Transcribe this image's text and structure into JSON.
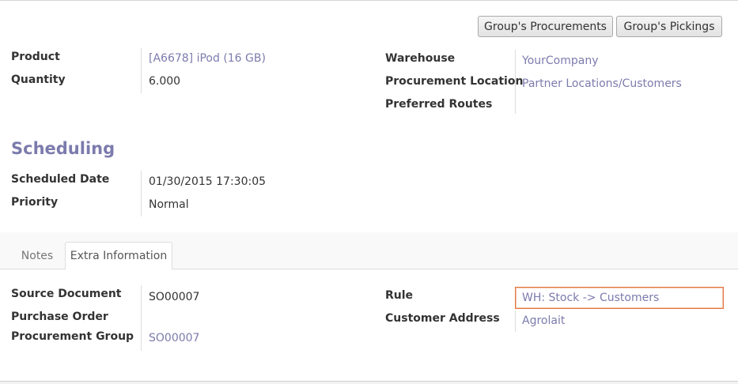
{
  "header": {
    "group_procurements_button": "Group's Procurements",
    "group_pickings_button": "Group's Pickings"
  },
  "main": {
    "product_label": "Product",
    "product_value": "[A6678] iPod (16 GB)",
    "quantity_label": "Quantity",
    "quantity_value": "6.000",
    "warehouse_label": "Warehouse",
    "warehouse_value": "YourCompany",
    "procurement_location_label": "Procurement Location",
    "procurement_location_value": "Partner Locations/Customers",
    "preferred_routes_label": "Preferred Routes"
  },
  "scheduling": {
    "title": "Scheduling",
    "scheduled_date_label": "Scheduled Date",
    "scheduled_date_value": "01/30/2015 17:30:05",
    "priority_label": "Priority",
    "priority_value": "Normal"
  },
  "tabs": [
    {
      "label": "Notes",
      "active": false
    },
    {
      "label": "Extra Information",
      "active": true
    }
  ],
  "extra": {
    "source_document_label": "Source Document",
    "source_document_value": "SO00007",
    "purchase_order_label": "Purchase Order",
    "procurement_group_label": "Procurement Group",
    "procurement_group_value": "SO00007",
    "rule_label": "Rule",
    "rule_value": "WH: Stock -> Customers",
    "customer_address_label": "Customer Address",
    "customer_address_value": "Agrolait"
  },
  "colors": {
    "link": "#7c7bad",
    "focus_border": "#e4753e"
  }
}
